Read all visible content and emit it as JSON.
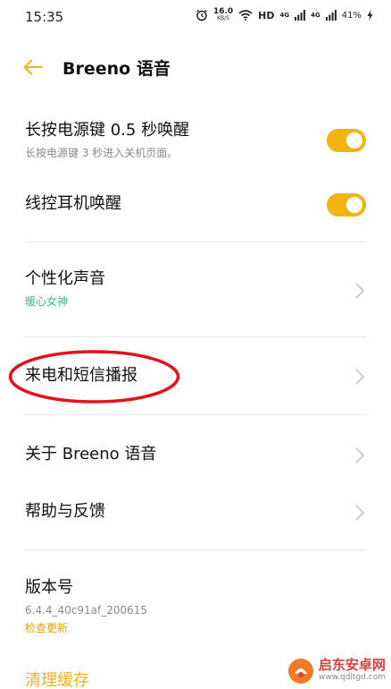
{
  "status_bar": {
    "time": "15:35",
    "speed_value": "16.0",
    "speed_unit": "KB/S",
    "hd_label": "HD",
    "net_label_1": "4G",
    "net_label_2": "4G",
    "battery": "41%"
  },
  "header": {
    "title": "Breeno 语音",
    "accent_color": "#f2b410"
  },
  "settings": {
    "power_key": {
      "title": "长按电源键 0.5 秒唤醒",
      "subtitle": "长按电源键 3 秒进入关机页面。",
      "enabled": true
    },
    "wired_headset": {
      "title": "线控耳机唤醒",
      "enabled": true
    },
    "personal_voice": {
      "title": "个性化声音",
      "value": "暖心女神"
    },
    "call_sms_broadcast": {
      "title": "来电和短信播报"
    },
    "about": {
      "title": "关于 Breeno 语音"
    },
    "help": {
      "title": "帮助与反馈"
    },
    "version": {
      "title": "版本号",
      "value": "6.4.4_40c91af_200615",
      "check_update": "检查更新"
    },
    "clear_cache": "清理缓存"
  },
  "watermark": {
    "name": "启东安卓网",
    "url": "www.qdltgd.com"
  }
}
